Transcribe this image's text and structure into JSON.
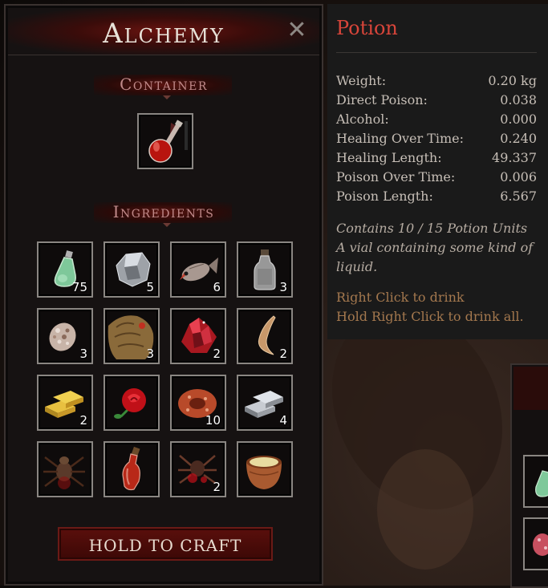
{
  "alchemy": {
    "title": "Alchemy",
    "container_label": "Container",
    "ingredients_label": "Ingredients",
    "craft_button": "HOLD TO CRAFT",
    "container_item": {
      "icon": "potion-flask-icon"
    },
    "ingredients": [
      {
        "icon": "green-vial-icon",
        "count": "75"
      },
      {
        "icon": "silver-ore-icon",
        "count": "5"
      },
      {
        "icon": "fish-icon",
        "count": "6"
      },
      {
        "icon": "glass-bottle-icon",
        "count": "3"
      },
      {
        "icon": "mushroom-spore-icon",
        "count": "3"
      },
      {
        "icon": "creature-hide-icon",
        "count": "3"
      },
      {
        "icon": "red-crystal-icon",
        "count": "2"
      },
      {
        "icon": "tusk-icon",
        "count": "2"
      },
      {
        "icon": "gold-bars-icon",
        "count": "2"
      },
      {
        "icon": "red-rose-icon",
        "count": ""
      },
      {
        "icon": "red-fungus-icon",
        "count": "10"
      },
      {
        "icon": "silver-bars-icon",
        "count": "4"
      },
      {
        "icon": "spider-icon",
        "count": ""
      },
      {
        "icon": "wine-bottle-icon",
        "count": ""
      },
      {
        "icon": "spider-blood-icon",
        "count": "2"
      },
      {
        "icon": "clay-pot-icon",
        "count": ""
      }
    ]
  },
  "tooltip": {
    "title": "Potion",
    "stats": [
      {
        "label": "Weight:",
        "value": "0.20 kg"
      },
      {
        "label": "Direct Poison:",
        "value": "0.038"
      },
      {
        "label": "Alcohol:",
        "value": "0.000"
      },
      {
        "label": "Healing Over Time:",
        "value": "0.240"
      },
      {
        "label": "Healing Length:",
        "value": "49.337"
      },
      {
        "label": "Poison Over Time:",
        "value": "0.006"
      },
      {
        "label": "Poison Length:",
        "value": "6.567"
      }
    ],
    "units_line": "Contains 10 / 15 Potion Units",
    "description_line1": "A vial containing some kind of",
    "description_line2": "liquid.",
    "hint_drink": "Right Click to drink",
    "hint_drink_all": "Hold Right Click to drink all."
  },
  "colors": {
    "accent_red": "#d8453a",
    "hint_text": "#a4784e",
    "slot_border": "#8a8682",
    "button_red": "#5a0f0c"
  }
}
